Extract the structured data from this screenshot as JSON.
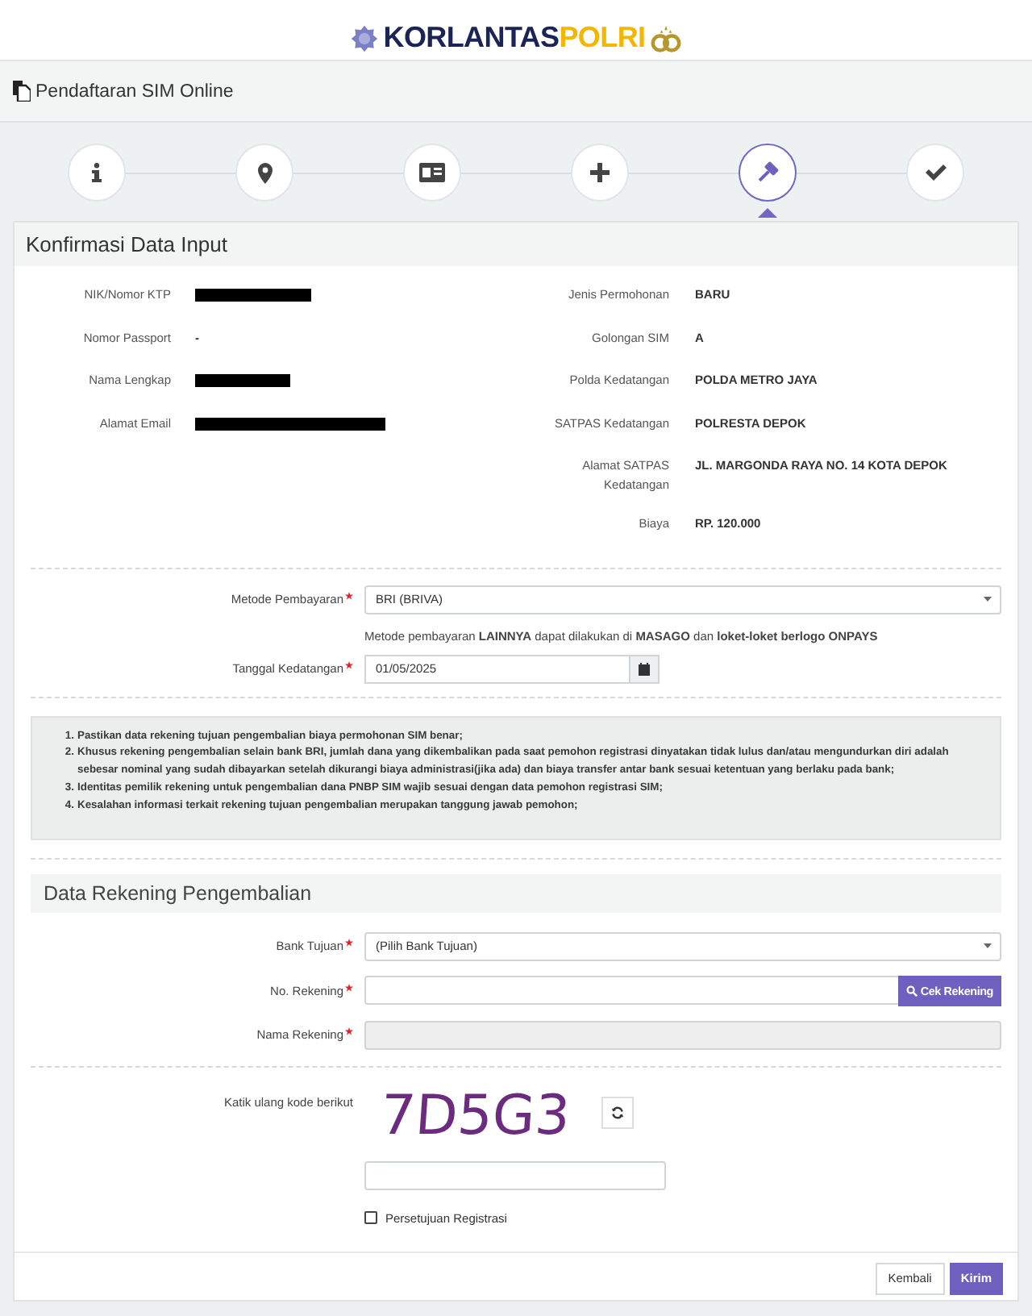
{
  "brand": {
    "name": "KORLANTAS",
    "accent": "POLRI"
  },
  "title_bar": {
    "title": "Pendaftaran SIM Online"
  },
  "steps": [
    {
      "selected": false
    },
    {
      "selected": false
    },
    {
      "selected": false
    },
    {
      "selected": false
    },
    {
      "selected": true
    },
    {
      "selected": false
    }
  ],
  "confirmation": {
    "title": "Konfirmasi Data Input",
    "left": [
      {
        "label": "NIK/Nomor KTP",
        "redacted": true
      },
      {
        "label": "Nomor Passport",
        "value": "-",
        "redacted": false
      },
      {
        "label": "Nama Lengkap",
        "redacted": true
      },
      {
        "label": "Alamat Email",
        "redacted": true
      }
    ],
    "right": [
      {
        "label": "Jenis Permohonan",
        "value": "BARU"
      },
      {
        "label": "Golongan SIM",
        "value": "A"
      },
      {
        "label": "Polda Kedatangan",
        "value": "POLDA METRO JAYA"
      },
      {
        "label": "SATPAS Kedatangan",
        "value": "POLRESTA DEPOK"
      },
      {
        "label": "Alamat SATPAS Kedatangan",
        "value": "JL. MARGONDA RAYA NO. 14 KOTA DEPOK"
      },
      {
        "label": "Biaya",
        "value": "RP. 120.000"
      }
    ],
    "payment_method": {
      "label": "Metode Pembayaran",
      "required": true,
      "value": "BRI (BRIVA)",
      "help": "Metode pembayaran **LAINNYA** dapat dilakukan di **MASAGO** dan **loket-loket berlogo ONPAYS**"
    },
    "arrival_date": {
      "label": "Tanggal Kedatangan",
      "required": true,
      "value": "01/05/2025"
    },
    "notes": [
      {
        "number": "1.",
        "text": "Pastikan data rekening tujuan pengembalian biaya permohonan SIM benar;"
      },
      {
        "number": "2.",
        "text": "Khusus rekening pengembalian selain bank BRI, jumlah dana yang dikembalikan pada saat pemohon registrasi dinyatakan tidak lulus dan/atau mengundurkan diri adalah sebesar nominal yang sudah dibayarkan setelah dikurangi biaya administrasi(jika ada) dan biaya transfer antar bank sesuai ketentuan yang berlaku pada bank;"
      },
      {
        "number": "3.",
        "text": "Identitas pemilik rekening untuk pengembalian dana PNBP SIM wajib sesuai dengan data pemohon registrasi SIM;"
      },
      {
        "number": "4.",
        "text": "Kesalahan informasi terkait rekening tujuan pengembalian merupakan tanggung jawab pemohon;"
      }
    ]
  },
  "refund": {
    "title": "Data Rekening Pengembalian",
    "bank": {
      "label": "Bank Tujuan",
      "required": true,
      "value": "(Pilih Bank Tujuan)"
    },
    "account_number": {
      "label": "No. Rekening",
      "required": true,
      "button": "Cek Rekening"
    },
    "account_name": {
      "label": "Nama Rekening",
      "required": true,
      "disabled": true
    },
    "captcha": {
      "label": "Katik ulang kode berikut",
      "code": "7D5G3"
    },
    "consent": {
      "label": "Persetujuan Registrasi",
      "checked": false
    }
  },
  "buttons": {
    "back": "Kembali",
    "submit": "Kirim"
  }
}
